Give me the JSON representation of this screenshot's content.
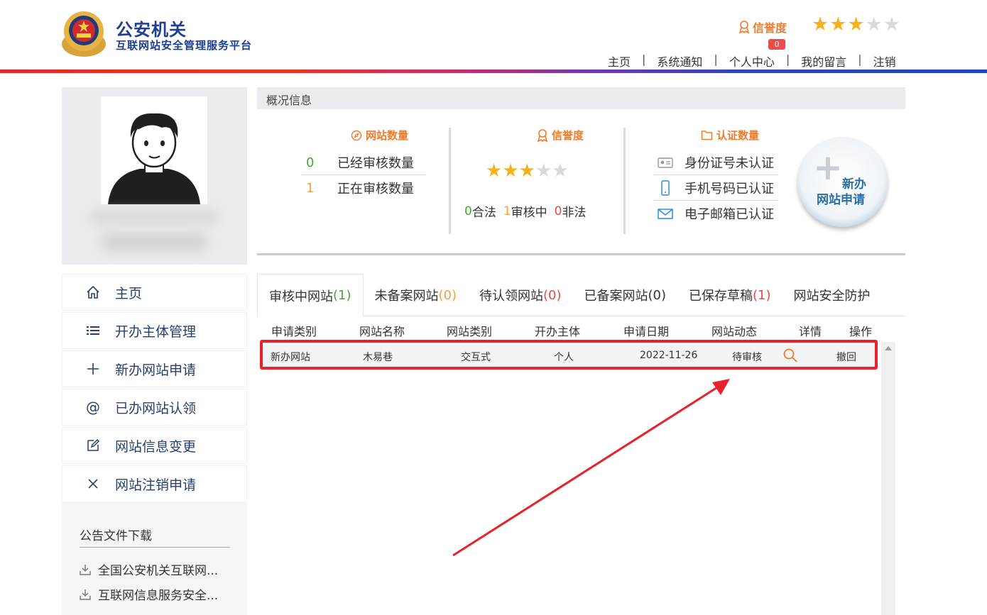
{
  "header": {
    "org_title": "公安机关",
    "org_subtitle": "互联网站安全管理服务平台",
    "credit_label": "信誉度",
    "credit_stars": 3,
    "credit_stars_max": 5,
    "notification_count": "0",
    "nav": [
      "主页",
      "系统通知",
      "个人中心",
      "我的留言",
      "注销"
    ],
    "nav_separator": "|"
  },
  "sidebar": {
    "items": [
      {
        "label": "主页",
        "icon": "home-icon"
      },
      {
        "label": "开办主体管理",
        "icon": "list-icon"
      },
      {
        "label": "新办网站申请",
        "icon": "plus-icon"
      },
      {
        "label": "已办网站认领",
        "icon": "at-icon"
      },
      {
        "label": "网站信息变更",
        "icon": "edit-icon"
      },
      {
        "label": "网站注销申请",
        "icon": "close-icon"
      }
    ],
    "downloads_title": "公告文件下载",
    "downloads": [
      "全国公安机关互联网...",
      "互联网信息服务安全..."
    ]
  },
  "overview": {
    "title": "概况信息",
    "site_count": {
      "title": "网站数量",
      "approved_value": "0",
      "approved_label": "已经审核数量",
      "pending_value": "1",
      "pending_label": "正在审核数量"
    },
    "credit": {
      "title": "信誉度",
      "stars": 3,
      "stars_max": 5,
      "legal_value": "0",
      "legal_label": "合法",
      "reviewing_value": "1",
      "reviewing_label": "审核中",
      "illegal_value": "0",
      "illegal_label": "非法"
    },
    "auth": {
      "title": "认证数量",
      "id_label": "身份证号未认证",
      "phone_label": "手机号码已认证",
      "email_label": "电子邮箱已认证"
    },
    "new_button_line1": "新办",
    "new_button_line2": "网站申请"
  },
  "tabs": [
    {
      "label": "审核中网站",
      "count": "(1)",
      "count_color": "#48a734"
    },
    {
      "label": "未备案网站",
      "count": "(0)",
      "count_color": "#f0a33a"
    },
    {
      "label": "待认领网站",
      "count": "(0)",
      "count_color": "#e54a4a"
    },
    {
      "label": "已备案网站",
      "count": "(0)",
      "count_color": "#333333"
    },
    {
      "label": "已保存草稿",
      "count": "(1)",
      "count_color": "#e54a4a"
    },
    {
      "label": "网站安全防护",
      "count": "",
      "count_color": "#333333"
    }
  ],
  "table": {
    "columns": [
      "申请类别",
      "网站名称",
      "网站类别",
      "开办主体",
      "申请日期",
      "网站动态",
      "详情",
      "操作"
    ],
    "rows": [
      {
        "type": "新办网站",
        "name": "木易巷",
        "category": "交互式",
        "subject": "个人",
        "date": "2022-11-26",
        "status": "待审核",
        "action": "撤回"
      }
    ]
  },
  "colors": {
    "brand_blue": "#1e3f8f",
    "accent_orange": "#f07b2a",
    "highlight_red": "#e8212a"
  }
}
